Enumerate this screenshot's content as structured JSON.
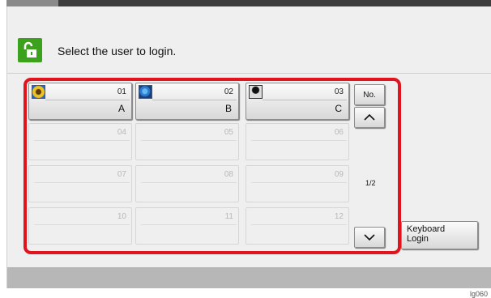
{
  "header": {
    "prompt": "Select the user to login.",
    "lock_icon": "unlock-icon"
  },
  "users": [
    {
      "number": "01",
      "name": "A",
      "avatar": "sunflower-avatar-icon"
    },
    {
      "number": "02",
      "name": "B",
      "avatar": "globe-avatar-icon"
    },
    {
      "number": "03",
      "name": "C",
      "avatar": "person-silhouette-avatar-icon"
    },
    {
      "number": "04",
      "name": ""
    },
    {
      "number": "05",
      "name": ""
    },
    {
      "number": "06",
      "name": ""
    },
    {
      "number": "07",
      "name": ""
    },
    {
      "number": "08",
      "name": ""
    },
    {
      "number": "09",
      "name": ""
    },
    {
      "number": "10",
      "name": ""
    },
    {
      "number": "11",
      "name": ""
    },
    {
      "number": "12",
      "name": ""
    }
  ],
  "side": {
    "sort_label": "No.",
    "page_indicator": "1/2",
    "up_icon": "chevron-up-icon",
    "down_icon": "chevron-down-icon"
  },
  "keyboard_login": {
    "label_line1": "Keyboard",
    "label_line2": "Login"
  },
  "image_ref": "lg060",
  "colors": {
    "highlight": "#e1141e",
    "lock_badge": "#3ca21e",
    "top_bar": "#3d3d3d",
    "footer_bar": "#b7b7b7"
  }
}
